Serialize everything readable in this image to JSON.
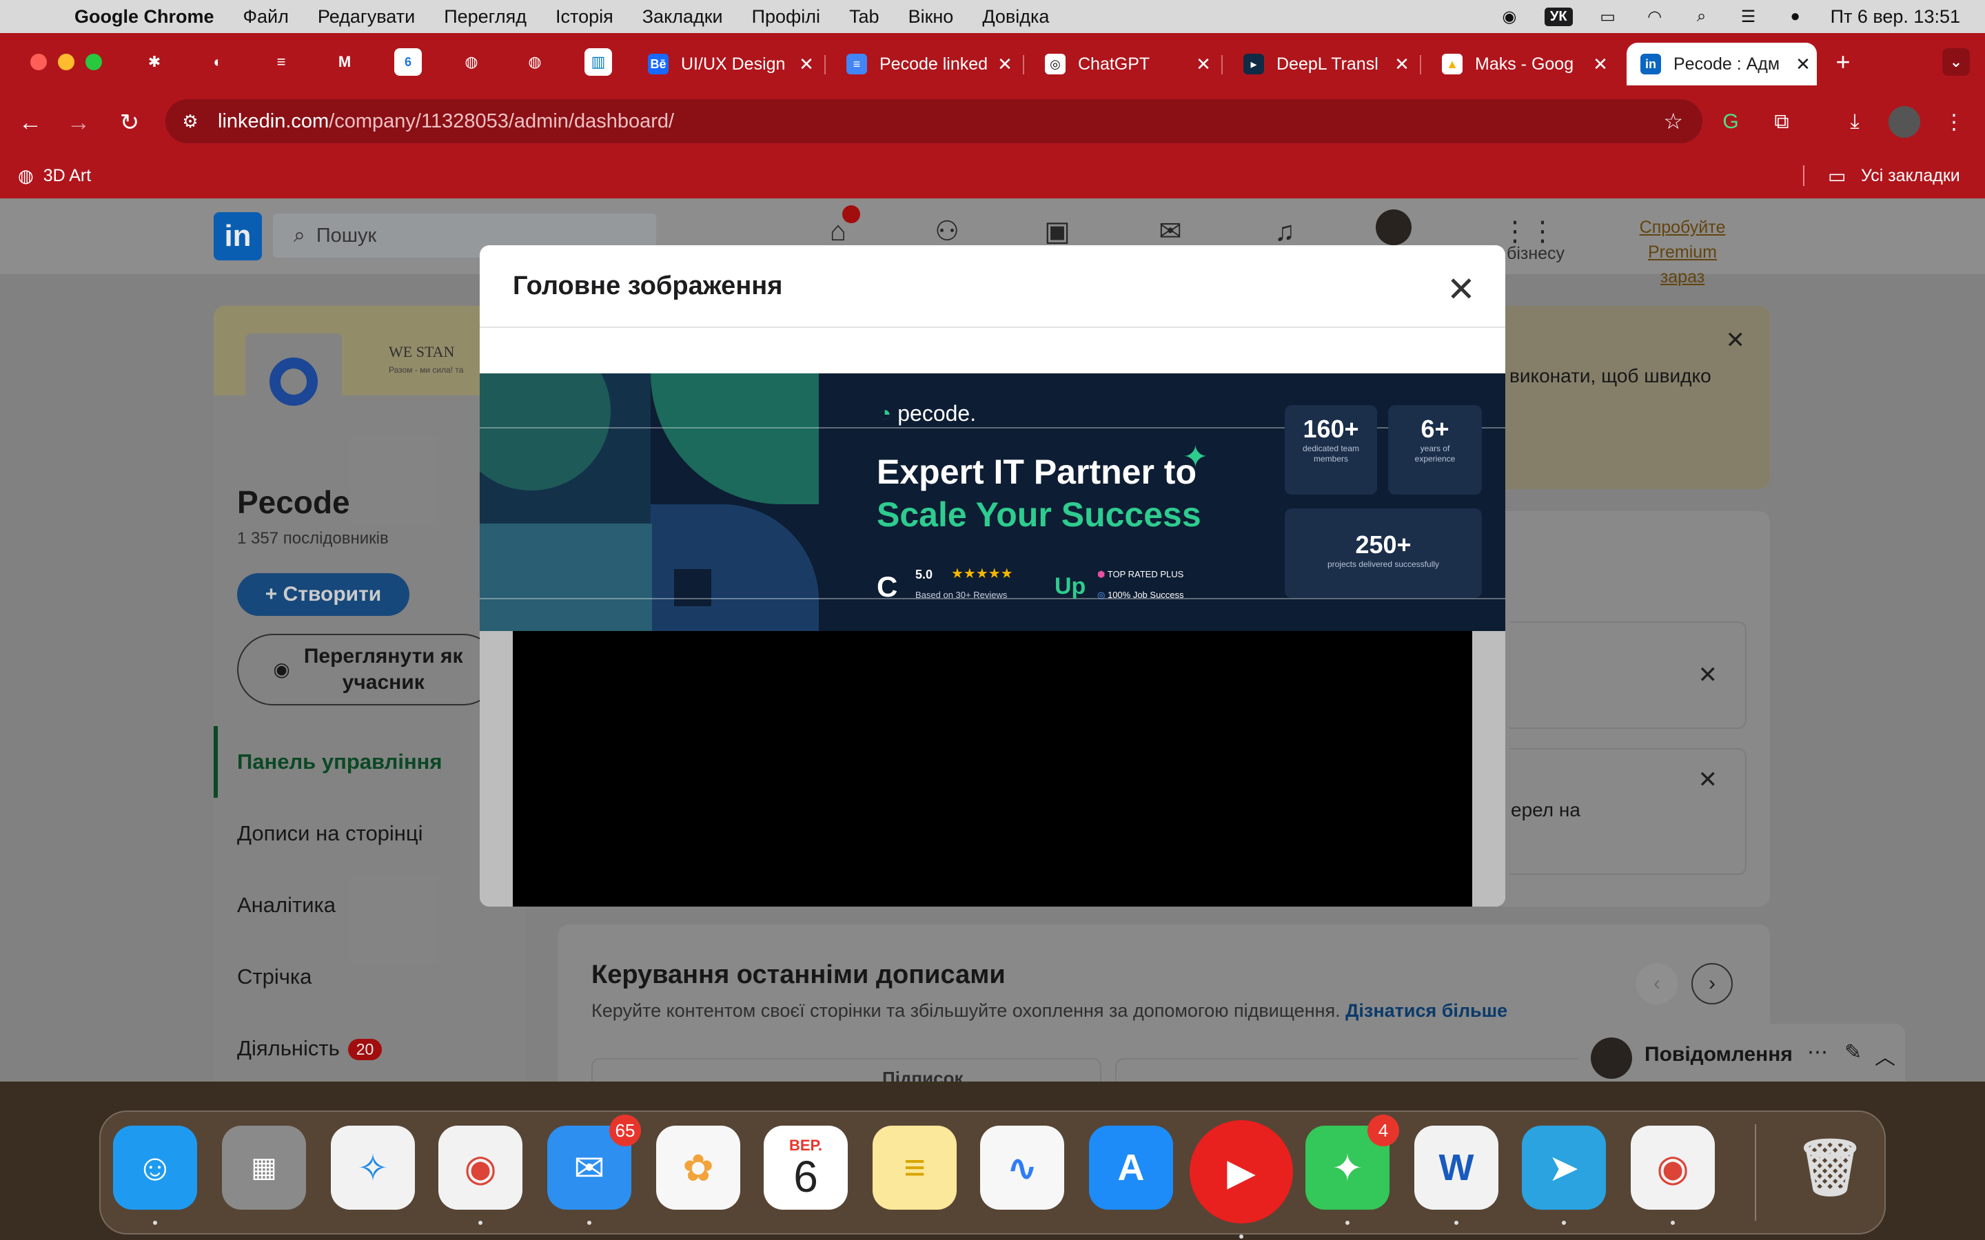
{
  "menubar": {
    "app_name": "Google Chrome",
    "items": [
      "Файл",
      "Редагувати",
      "Перегляд",
      "Історія",
      "Закладки",
      "Профілі",
      "Tab",
      "Вікно",
      "Довідка"
    ],
    "input_lang": "УК",
    "datetime": "Пт 6 вер.  13:51"
  },
  "tabs": [
    {
      "title": "UI/UX Design",
      "favicon": "Bē"
    },
    {
      "title": "Pecode linked",
      "favicon": "≡"
    },
    {
      "title": "ChatGPT",
      "favicon": "◎"
    },
    {
      "title": "DeepL Transl",
      "favicon": "▸"
    },
    {
      "title": "Maks - Goog",
      "favicon": "▲"
    },
    {
      "title": "Pecode : Адм",
      "favicon": "in"
    }
  ],
  "address": {
    "domain": "linkedin.com",
    "path": "/company/11328053/admin/dashboard/"
  },
  "bookmarks": {
    "left_item": "3D Art",
    "right_item": "Усі закладки"
  },
  "linkedin": {
    "search_placeholder": "Пошук",
    "business_label": "бізнесу",
    "premium_line1": "Спробуйте Premium",
    "premium_line2": "зараз",
    "home_badge": "",
    "banner_text_1": "WE STAN",
    "banner_text_2": "Разом - ми сила! та",
    "company_name": "Pecode",
    "followers": "1 357 послідовників",
    "create_button": "+ Створити",
    "view_as_member_line1": "Переглянути як",
    "view_as_member_line2": "учасник",
    "menu": {
      "dashboard": "Панель управління",
      "posts": "Дописи на сторінці",
      "analytics": "Аналітика",
      "feed": "Стрічка",
      "activity": "Діяльність",
      "activity_count": "20"
    },
    "alert_text": "виконати, щоб швидко",
    "card_text": "ерел на",
    "recent_title": "Керування останніми дописами",
    "recent_subtitle": "Керуйте контентом своєї сторінки та збільшуйте охоплення за допомогою підвищення.",
    "recent_link": "Дізнатися більше",
    "cutoff_text": "Підписок",
    "messaging": "Повідомлення"
  },
  "modal": {
    "title": "Головне зображення",
    "banner": {
      "logo": "pecode.",
      "headline_1": "Expert IT Partner to",
      "headline_2": "Scale Your Success",
      "rating": "5.0",
      "stars": "★★★★★",
      "rating_note": "Based on 30+ Reviews",
      "upwork_1": "TOP RATED PLUS",
      "upwork_2": "100% Job Success",
      "stat1_num": "160+",
      "stat1_lbl": "dedicated team members",
      "stat2_num": "6+",
      "stat2_lbl": "years of experience",
      "stat3_num": "250+",
      "stat3_lbl": "projects delivered successfully"
    }
  },
  "dock": {
    "mail_badge": "65",
    "messages_badge": "4",
    "calendar_month": "ВЕР.",
    "calendar_day": "6"
  },
  "colors": {
    "chrome_red": "#b0151c",
    "linkedin_blue": "#0a66c2",
    "banner_bg": "#0d1d33",
    "banner_green": "#2ecc8f"
  }
}
